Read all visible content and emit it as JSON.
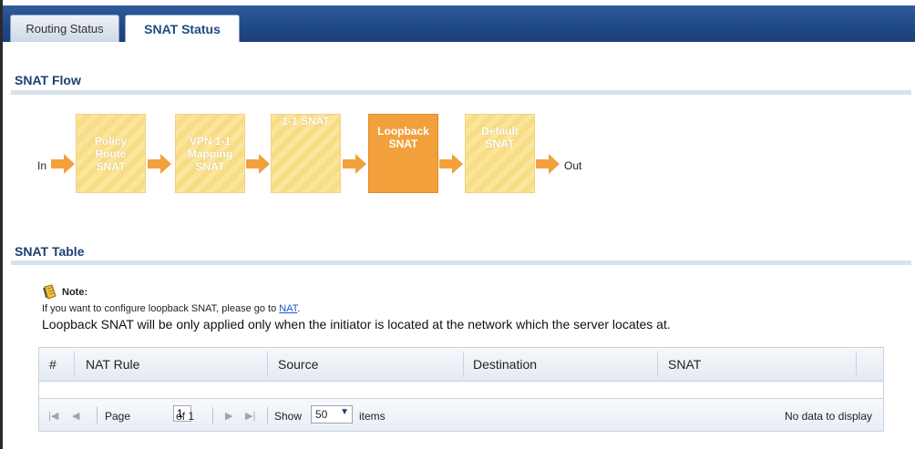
{
  "tabs": [
    {
      "label": "Routing Status",
      "active": false
    },
    {
      "label": "SNAT Status",
      "active": true
    }
  ],
  "flow": {
    "title": "SNAT Flow",
    "in_label": "In",
    "out_label": "Out",
    "steps": [
      {
        "label": "Policy\nRoute\nSNAT",
        "highlighted": false
      },
      {
        "label": "VPN 1-1\nMapping\nSNAT",
        "highlighted": false
      },
      {
        "label": "1-1 SNAT",
        "highlighted": false
      },
      {
        "label": "Loopback\nSNAT",
        "highlighted": true
      },
      {
        "label": "Default\nSNAT",
        "highlighted": false
      }
    ],
    "arrow_color": "#f2a03c"
  },
  "table_section": {
    "title": "SNAT Table",
    "note_label": "Note:",
    "note_line1_text": "If you want to configure loopback SNAT, please go to ",
    "note_link": "NAT",
    "note_line1_end": ".",
    "note_line2": "Loopback SNAT will be only applied only when the initiator is located at the network which the server locates at."
  },
  "table": {
    "columns": [
      "#",
      "NAT Rule",
      "Source",
      "Destination",
      "SNAT"
    ],
    "rows": []
  },
  "pager": {
    "page_label": "Page",
    "page_value": "1",
    "of_label": "of 1",
    "show_label": "Show",
    "show_value": "50",
    "items_label": "items",
    "empty_text": "No data to display"
  },
  "colors": {
    "tabbar": "#1f4886",
    "section_title": "#1e3f73",
    "highlight_box": "#f2a03c",
    "box_fill": "#fbe59a"
  }
}
